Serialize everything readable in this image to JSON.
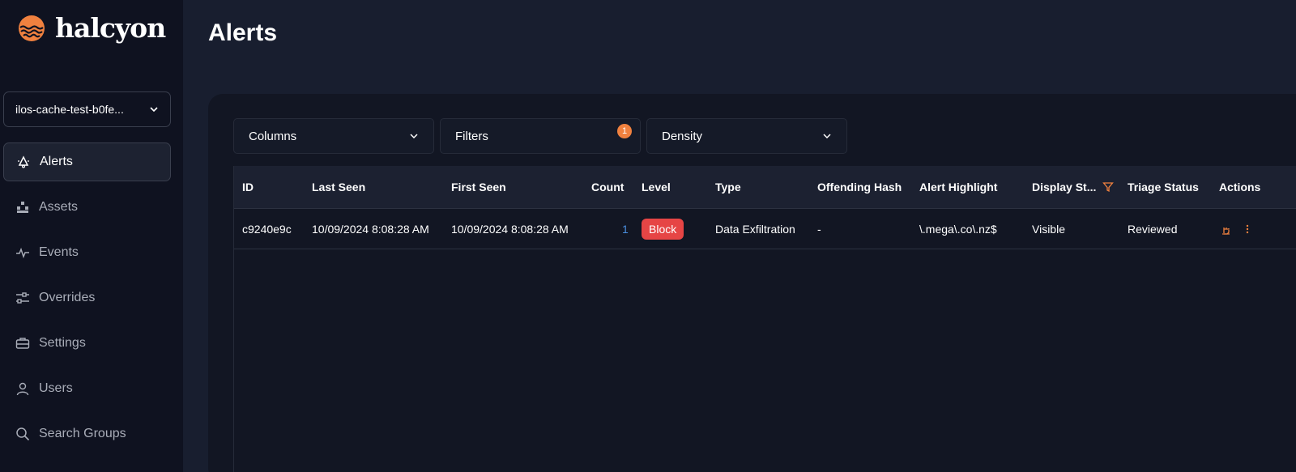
{
  "app": {
    "name": "halcyon",
    "accent": "#f0813f"
  },
  "sidebar": {
    "org_selector": {
      "value": "ilos-cache-test-b0fe..."
    },
    "items": [
      {
        "label": "Alerts",
        "icon": "bell-icon",
        "active": true
      },
      {
        "label": "Assets",
        "icon": "assets-icon"
      },
      {
        "label": "Events",
        "icon": "pulse-icon"
      },
      {
        "label": "Overrides",
        "icon": "sliders-icon"
      },
      {
        "label": "Settings",
        "icon": "toolbox-icon"
      },
      {
        "label": "Users",
        "icon": "user-icon"
      },
      {
        "label": "Search Groups",
        "icon": "search-icon"
      }
    ]
  },
  "page": {
    "title": "Alerts"
  },
  "toolbar": {
    "columns_label": "Columns",
    "filters_label": "Filters",
    "filters_count": "1",
    "density_label": "Density"
  },
  "table": {
    "headers": {
      "id": "ID",
      "last_seen": "Last Seen",
      "first_seen": "First Seen",
      "count": "Count",
      "level": "Level",
      "type": "Type",
      "offending_hash": "Offending Hash",
      "alert_highlight": "Alert Highlight",
      "display_status": "Display St...",
      "triage_status": "Triage Status",
      "actions": "Actions"
    },
    "rows": [
      {
        "id": "c9240e9c",
        "last_seen": "10/09/2024 8:08:28 AM",
        "first_seen": "10/09/2024 8:08:28 AM",
        "count": "1",
        "level": "Block",
        "type": "Data Exfiltration",
        "offending_hash": "-",
        "alert_highlight": "\\.mega\\.co\\.nz$",
        "display_status": "Visible",
        "triage_status": "Reviewed"
      }
    ]
  }
}
